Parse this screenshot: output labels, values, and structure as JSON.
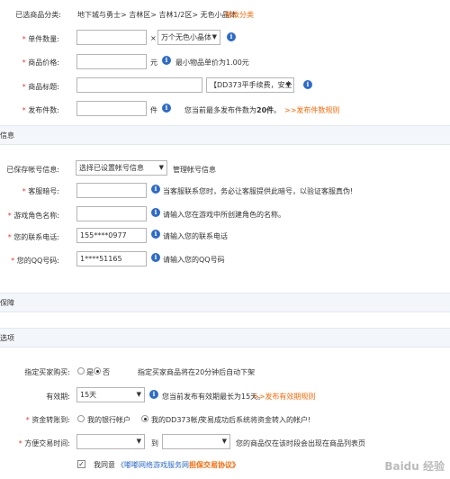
{
  "category": {
    "label": "已选商品分类:",
    "path": "地下城与勇士> 吉林区> 吉林1/2区> 无色小晶体",
    "modify": "修改分类"
  },
  "quantity": {
    "label": "单件数量:",
    "mult": "×",
    "unit_select": "万个无色小晶体"
  },
  "price": {
    "label": "商品价格:",
    "unit": "元",
    "hint": "最小物品单价为1.00元"
  },
  "title_field": {
    "label": "商品标题:",
    "prefix_select": "【DD373平手续费，安全"
  },
  "publish_count": {
    "label": "发布件数:",
    "unit": "件",
    "hint_pre": "您当前最多发布件数为",
    "hint_num": "20件",
    "hint_post": "。",
    "rule_link": ">>发布件数规则"
  },
  "account_section": {
    "title": "信息"
  },
  "saved_account": {
    "label": "已保存帐号信息:",
    "select": "选择已设置帐号信息",
    "manage": "管理帐号信息"
  },
  "kefu_id": {
    "label": "客服暗号:",
    "hint": "当客服联系您时，务必让客服提供此暗号，以验证客服真伪!"
  },
  "role_name": {
    "label": "游戏角色名称:",
    "hint": "请输入您在游戏中所创建角色的名称。"
  },
  "phone": {
    "label": "您的联系电话:",
    "value": "155****0977",
    "hint": "请输入您的联系电话"
  },
  "qq": {
    "label": "您的QQ号码:",
    "value": "1****51165",
    "hint": "请输入您的QQ号码"
  },
  "guarantee_section": {
    "title": "保障"
  },
  "options_section": {
    "title": "选项"
  },
  "buyer": {
    "label": "指定买家购买:",
    "yes": "是",
    "no": "否",
    "hint": "指定买家商品将在20分钟后自动下架"
  },
  "validity": {
    "label": "有效期:",
    "select": "15天",
    "hint": "您当前发布有效期最长为15天。",
    "rule_link": ">>发布有效期规则"
  },
  "transfer": {
    "label": "资金转账到:",
    "opt1": "我的银行帐户",
    "opt2": "我的DD373帐户",
    "hint": "交易成功后系统将资金转入的帐户!"
  },
  "trade_time": {
    "label": "方便交易时间:",
    "to": "到",
    "hint": "您的商品仅在该时段会出现在商品列表页"
  },
  "agree": {
    "text": "我同意",
    "link": "《嘟嘟网络游戏服务网",
    "link_bold": "担保交易协议》"
  },
  "watermark": "Baidu 经验"
}
